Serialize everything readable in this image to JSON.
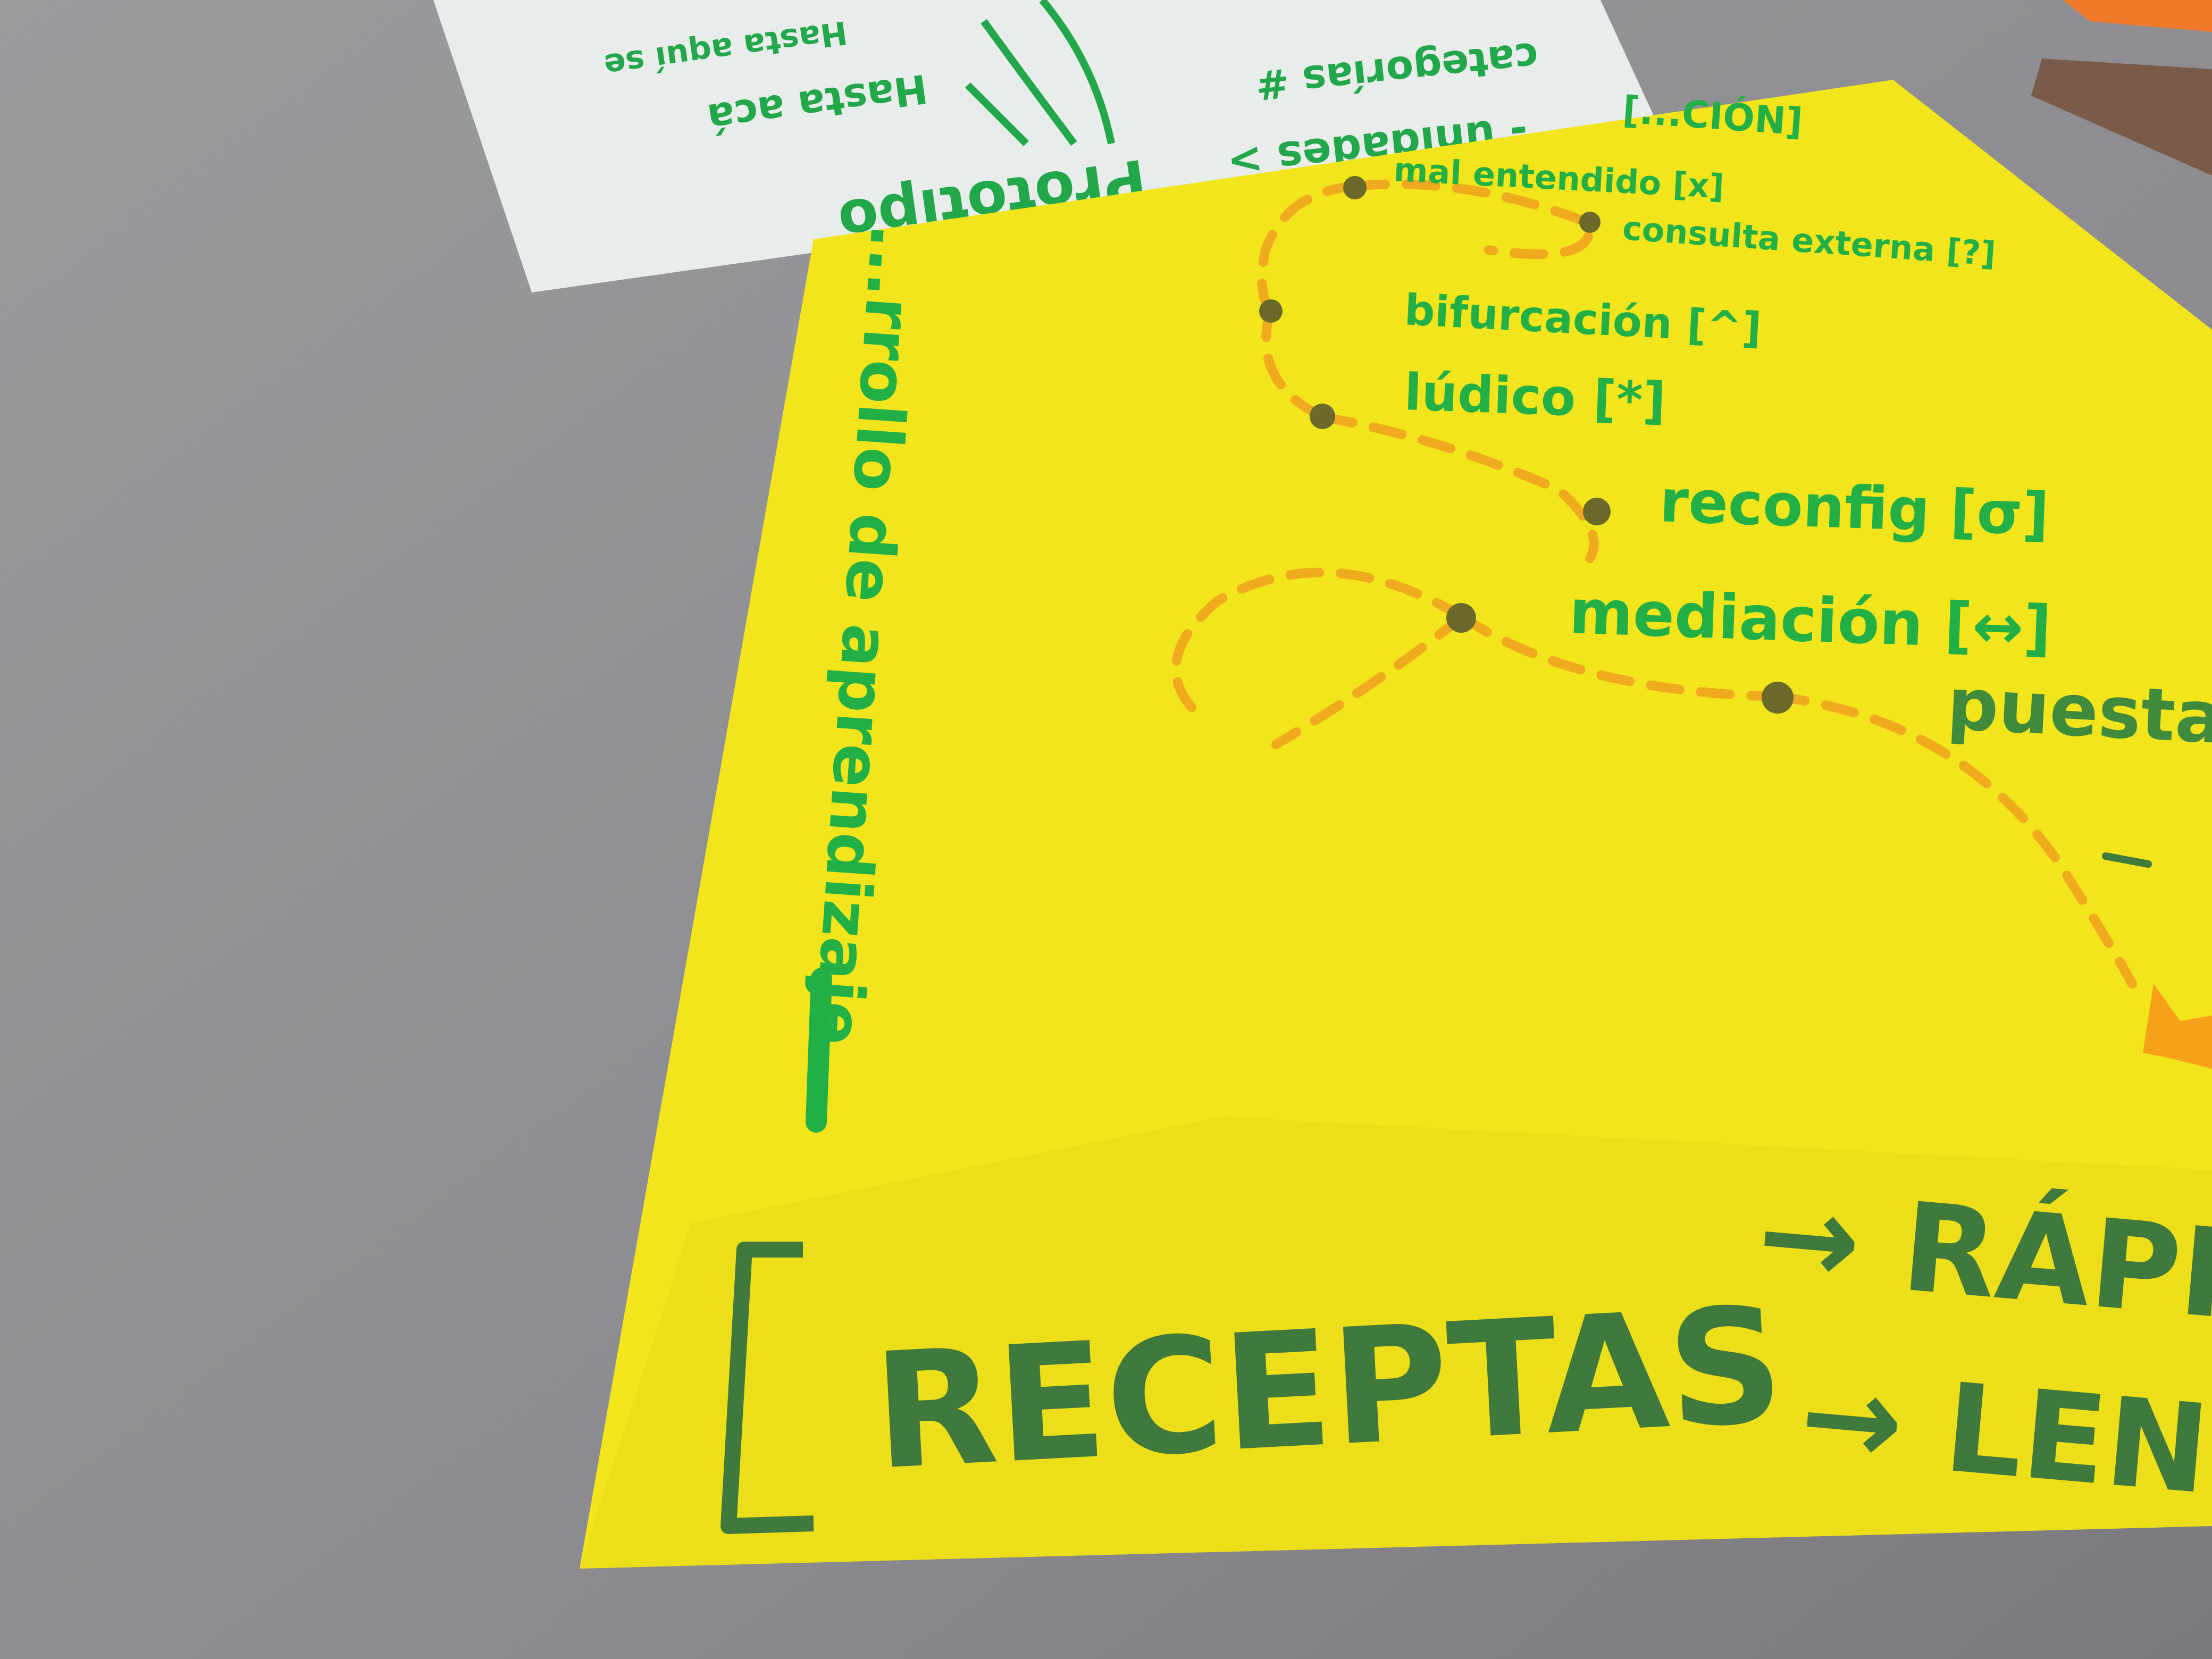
{
  "palette": {
    "table": "#8f8f92",
    "yellow_paper": "#f2e51c",
    "white_paper": "#e8ecea",
    "green_ink": "#22b046",
    "dark_green_ink": "#3f7a3c",
    "orange_dash": "#f0a01e",
    "dot": "#6b6a2a"
  },
  "white_paper": {
    "lines": [
      "Prototipo",
      "Hasta acá",
      "Hasta aquí se",
      "categorías #",
      "- unidades >"
    ]
  },
  "yellow_paper": {
    "top_fragment": "[...CIÓN]",
    "steps": [
      "mal entendido [x]",
      "consulta externa [?]",
      "bifurcación [^]",
      "lúdico [*]",
      "reconfig [σ]",
      "mediación [↔]",
      "puesta en com..."
    ],
    "vertical_label": "...rrollo de aprendizaje",
    "bracket_word": "RECEPTAS",
    "arrows": [
      "→ RÁPIT...",
      "→ LEN..."
    ]
  }
}
